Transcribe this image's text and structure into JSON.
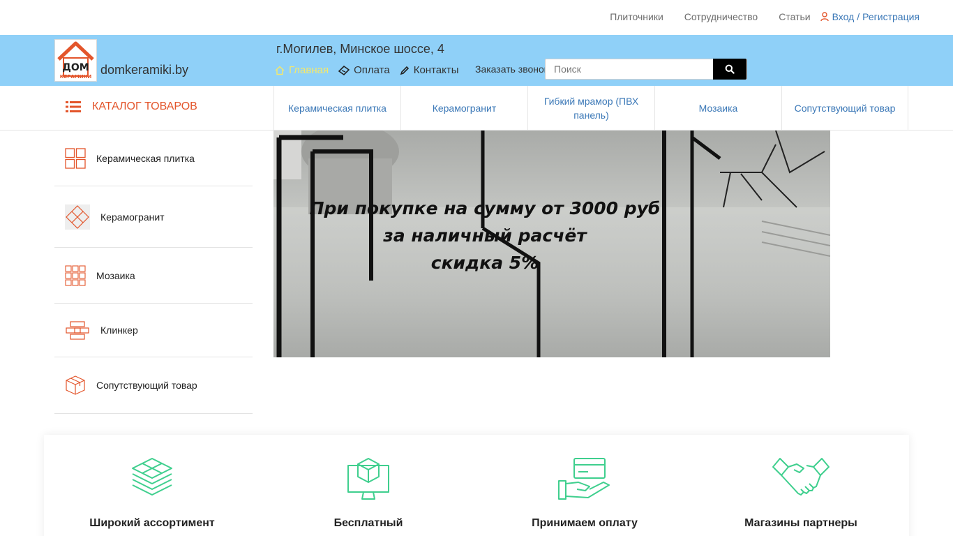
{
  "topnav": {
    "links": [
      "Плиточники",
      "Сотрудничество",
      "Статьи"
    ],
    "login": "Вход",
    "separator": "/",
    "register": "Регистрация"
  },
  "header": {
    "brand": "domkeramiki.by",
    "logo_line1": "ДОМ",
    "logo_line2": "КЕРАМИКИ",
    "address": "г.Могилев, Минское шоссе, 4",
    "nav": [
      "Главная",
      "Оплата",
      "Контакты"
    ],
    "callback": "Заказать звонок",
    "search_placeholder": "Поиск"
  },
  "catbar": {
    "catalog_label": "КАТАЛОГ ТОВАРОВ",
    "tabs": [
      "Керамическая плитка",
      "Керамогранит",
      "Гибкий мрамор (ПВХ панель)",
      "Мозаика",
      "Сопутствующий товар"
    ]
  },
  "sidebar": {
    "items": [
      "Керамическая плитка",
      "Керамогранит",
      "Мозаика",
      "Клинкер",
      "Сопутствующий товар"
    ]
  },
  "banner": {
    "line1": "При покупке на сумму от 3000 руб",
    "line2": "за наличный расчёт",
    "line3": "скидка 5%"
  },
  "features": [
    "Широкий ассортимент",
    "Бесплатный",
    "Принимаем оплату",
    "Магазины партнеры"
  ],
  "colors": {
    "header_bg": "#8fd0f8",
    "accent_orange": "#e3552b",
    "link_blue": "#3b78b7",
    "feature_green": "#3fcf8e",
    "active_nav": "#f5e86a"
  }
}
